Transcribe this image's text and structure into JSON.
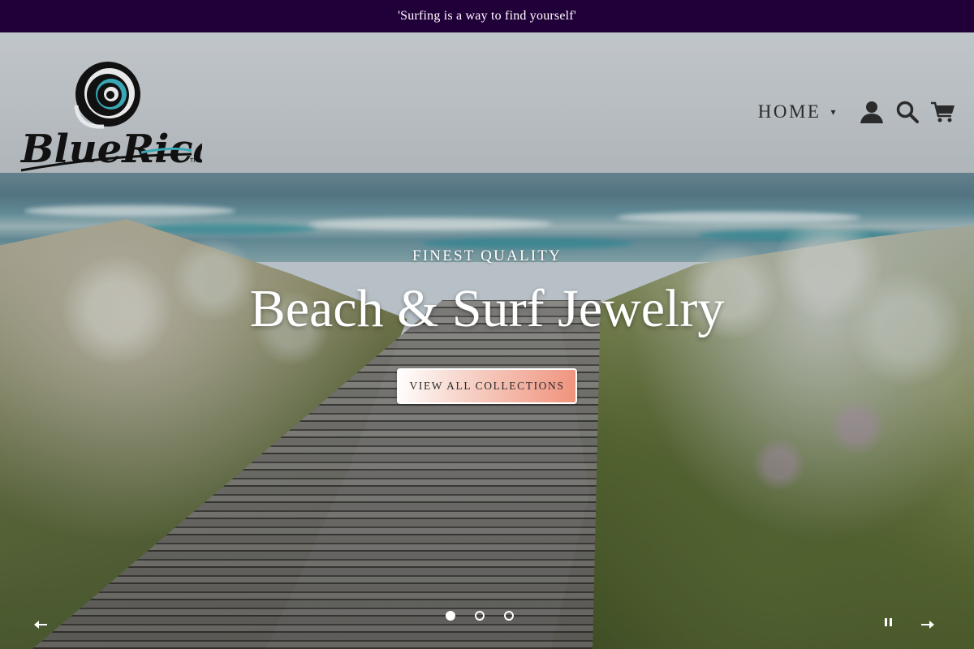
{
  "announcement": {
    "text": "'Surfing is a way to find yourself'"
  },
  "header": {
    "logo_text": "BlueRica",
    "logo_trademark": "TM",
    "nav": {
      "home_label": "HOME",
      "home_icon": "chevron-down-icon",
      "account_icon": "user-icon",
      "search_icon": "search-icon",
      "cart_icon": "cart-icon"
    }
  },
  "hero": {
    "eyebrow": "FINEST QUALITY",
    "headline": "Beach & Surf Jewelry",
    "cta_label": "VIEW ALL COLLECTIONS"
  },
  "slider": {
    "slide_count": 3,
    "active_index": 0,
    "prev_icon": "arrow-left-icon",
    "next_icon": "arrow-right-icon",
    "pause_icon": "pause-icon"
  },
  "colors": {
    "announcement_bg": "#21003a",
    "nav_text": "#2b2b2b",
    "logo_black": "#111111",
    "logo_teal": "#3aa7b5",
    "cta_gradient_start": "#ffffff",
    "cta_gradient_end": "#f0927c"
  }
}
